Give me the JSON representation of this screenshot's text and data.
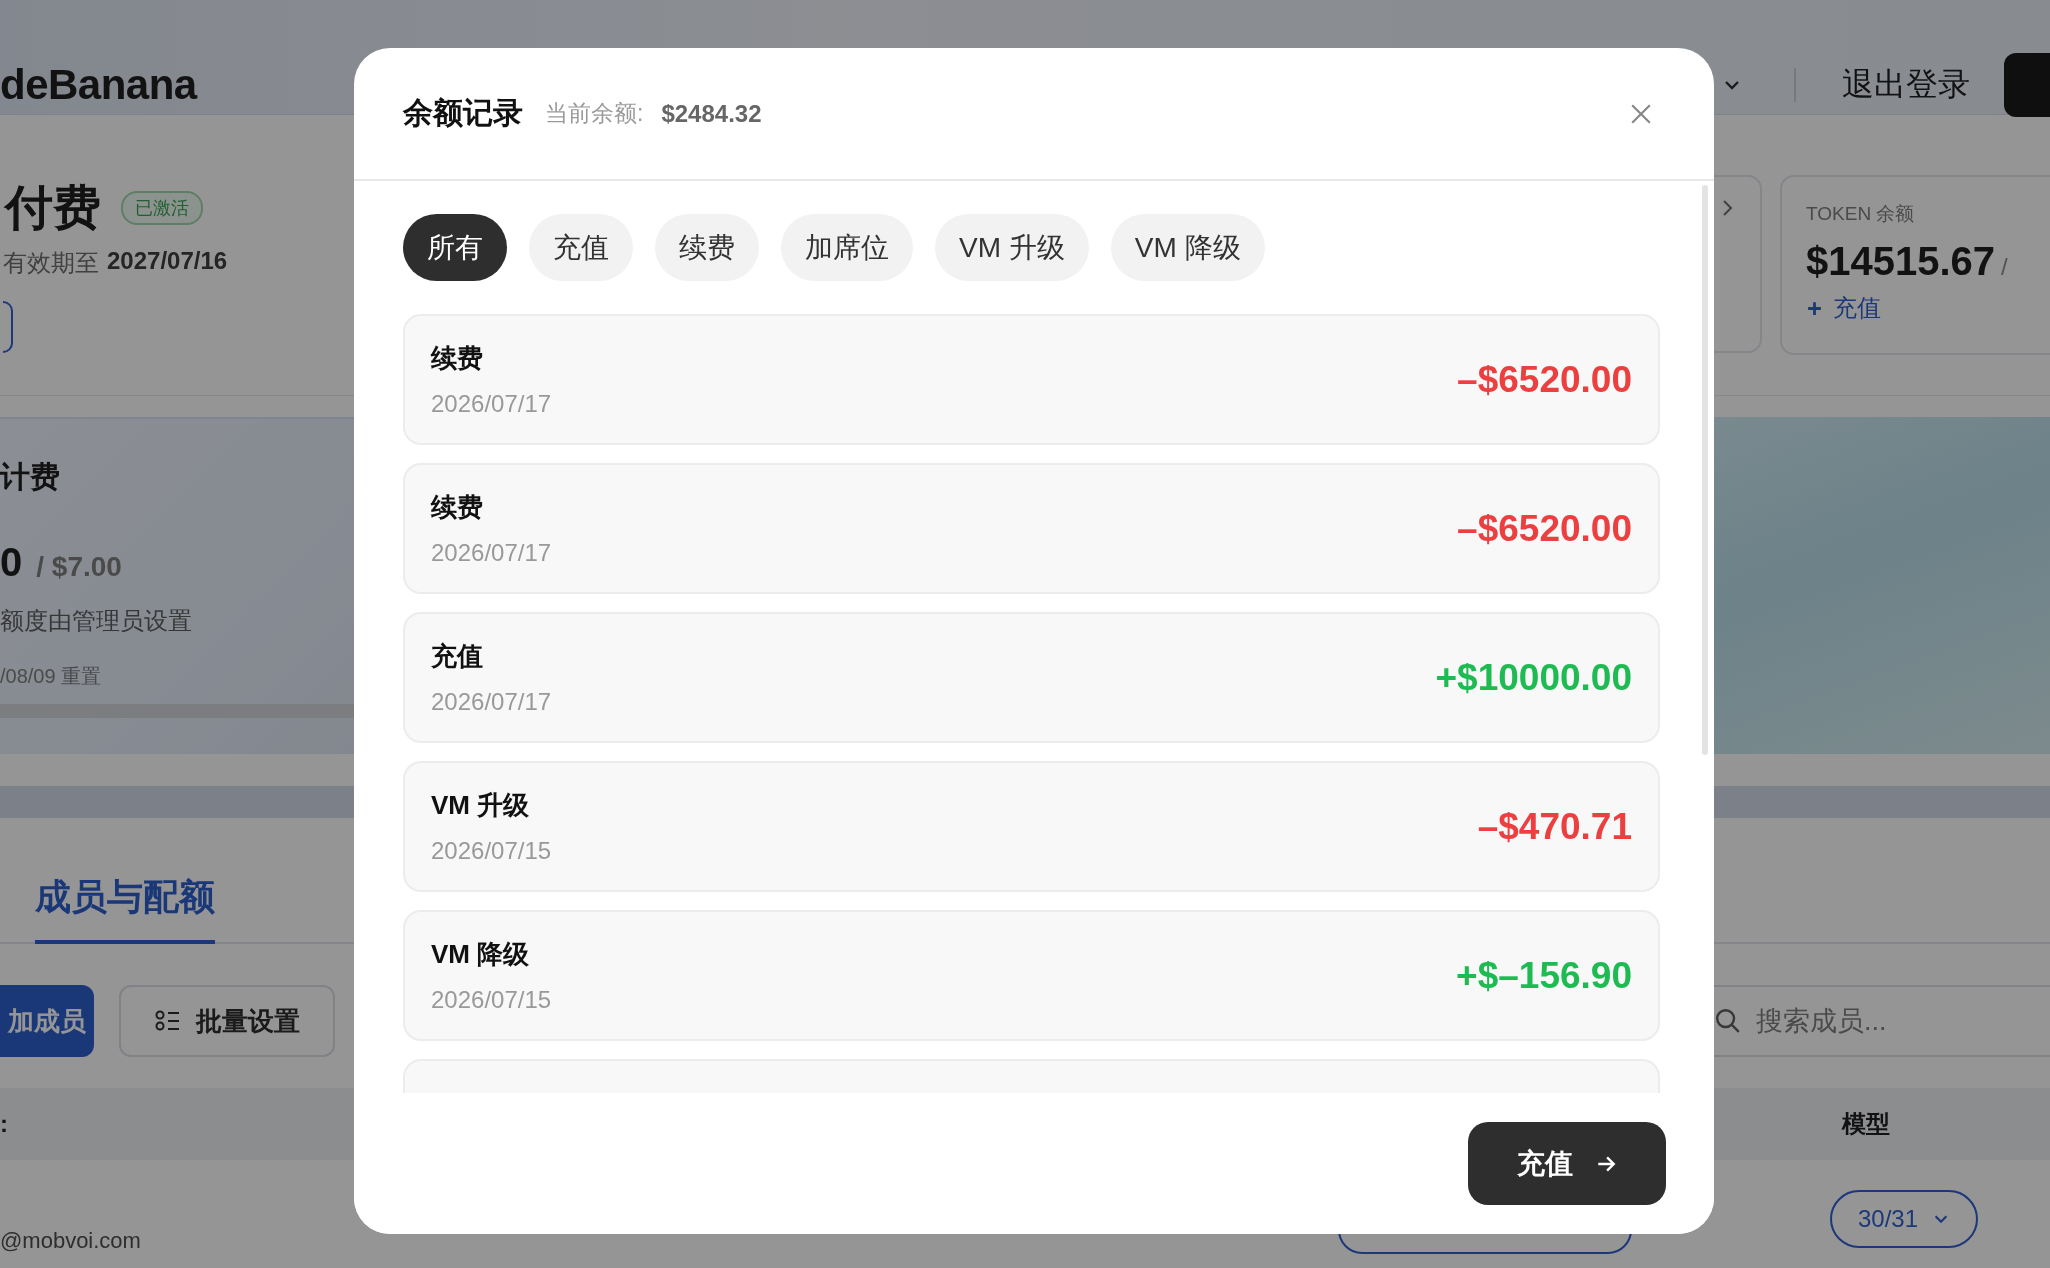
{
  "page": {
    "header": {
      "logo": "deBanana",
      "logout": "退出登录"
    },
    "plan": {
      "title": "付费",
      "badge": "已激活",
      "expiry_label": "有效期至",
      "expiry_date": "2027/07/16"
    },
    "token": {
      "label": "TOKEN 余额",
      "amount": "$14515.67",
      "separator": "/",
      "action": "充值"
    },
    "billing": {
      "title": "计费",
      "used": "0",
      "limit": "/ $7.00",
      "note": "额度由管理员设置",
      "reset": "/08/09 重置"
    },
    "tabs": [
      {
        "label": "成员与配额",
        "selected": true
      }
    ],
    "add_member": "加成员",
    "bulk_settings": "批量设置",
    "search": {
      "placeholder": "搜索成员..."
    },
    "table": {
      "columns": [
        ":",
        "模型"
      ],
      "rows": [
        {
          "email": "@mobvoi.com",
          "model": "30/31"
        }
      ]
    }
  },
  "dialog": {
    "title": "余额记录",
    "balance_label": "当前余额:",
    "balance": "$2484.32",
    "filters": [
      {
        "label": "所有",
        "selected": true
      },
      {
        "label": "充值",
        "selected": false
      },
      {
        "label": "续费",
        "selected": false
      },
      {
        "label": "加席位",
        "selected": false
      },
      {
        "label": "VM 升级",
        "selected": false
      },
      {
        "label": "VM 降级",
        "selected": false
      }
    ],
    "records": [
      {
        "type": "续费",
        "date": "2026/07/17",
        "amount": "–$6520.00",
        "kind": "debit"
      },
      {
        "type": "续费",
        "date": "2026/07/17",
        "amount": "–$6520.00",
        "kind": "debit"
      },
      {
        "type": "充值",
        "date": "2026/07/17",
        "amount": "+$10000.00",
        "kind": "credit"
      },
      {
        "type": "VM 升级",
        "date": "2026/07/15",
        "amount": "–$470.71",
        "kind": "debit"
      },
      {
        "type": "VM 降级",
        "date": "2026/07/15",
        "amount": "+$–156.90",
        "kind": "credit"
      }
    ],
    "action": "充值"
  }
}
